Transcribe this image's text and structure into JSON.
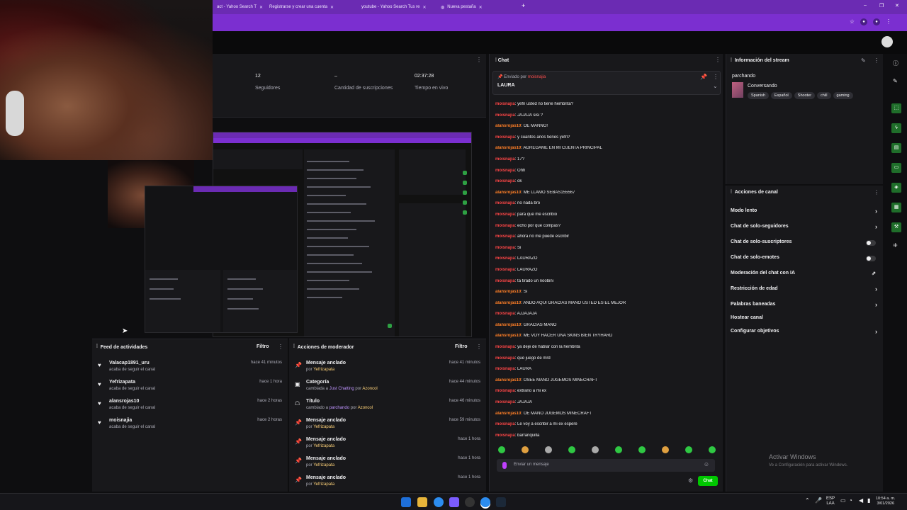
{
  "browser": {
    "tabs": [
      {
        "label": "act - Yahoo Search T"
      },
      {
        "label": "Registrarse y crear una cuenta"
      },
      {
        "label": "youtube - Yahoo Search Tus re"
      },
      {
        "label": "Nueva pestaña"
      }
    ],
    "new_tab": "+",
    "window_controls": [
      "–",
      "❐",
      "✕"
    ]
  },
  "stats": {
    "followers_value": "12",
    "followers_label": "Seguidores",
    "subs_value": "–",
    "subs_label": "Cantidad de suscripciones",
    "live_value": "02:37:28",
    "live_label": "Tiempo en vivo"
  },
  "activity_feed": {
    "title": "Feed de actividades",
    "filter": "Filtro",
    "items": [
      {
        "name": "Valacap1891_uru",
        "desc": "acaba de seguir el canal",
        "time": "hace 41 minutos"
      },
      {
        "name": "Yefrizapata",
        "desc": "acaba de seguir el canal",
        "time": "hace 1 hora"
      },
      {
        "name": "alansrojas10",
        "desc": "acaba de seguir el canal",
        "time": "hace 2 horas"
      },
      {
        "name": "moisnajia",
        "desc": "acaba de seguir el canal",
        "time": "hace 2 horas"
      }
    ]
  },
  "mod_actions": {
    "title": "Acciones de moderador",
    "filter": "Filtro",
    "items": [
      {
        "name": "Mensaje anclado",
        "pre": "por",
        "user": "Yefrizapata",
        "time": "hace 41 minutos"
      },
      {
        "name": "Categoría",
        "pre": "cambiada a",
        "user": "Just Chatting",
        "mid": "por",
        "user2": "Azoncol",
        "time": "hace 44 minutos"
      },
      {
        "name": "Título",
        "pre": "cambiado a",
        "user": "parchando",
        "mid": "por",
        "user2": "Azoncol",
        "time": "hace 46 minutos"
      },
      {
        "name": "Mensaje anclado",
        "pre": "por",
        "user": "Yefrizapata",
        "time": "hace 59 minutos"
      },
      {
        "name": "Mensaje anclado",
        "pre": "por",
        "user": "Yefrizapata",
        "time": "hace 1 hora"
      },
      {
        "name": "Mensaje anclado",
        "pre": "por",
        "user": "Yefrizapata",
        "time": "hace 1 hora"
      },
      {
        "name": "Mensaje anclado",
        "pre": "por",
        "user": "Yefrizapata",
        "time": "hace 1 hora"
      }
    ]
  },
  "chat": {
    "title": "Chat",
    "pinned_by_label": "Enviado por",
    "pinned_by_user": "moisnajia",
    "pinned_message": "LAURA",
    "messages": [
      {
        "user": "moisnajia",
        "color": "red",
        "text": ": yefri usted no tiene hembrita?"
      },
      {
        "user": "moisnajia",
        "color": "red",
        "text": ": JAJAJA sisi ?"
      },
      {
        "user": "alansrojas10",
        "color": "orange",
        "text": ": OE MANNO!"
      },
      {
        "user": "moisnajia",
        "color": "red",
        "text": ": y cuantos años tienes yefri?"
      },
      {
        "user": "alansrojas10",
        "color": "orange",
        "text": ": AGREGAME EN MI CUENTA PRINCIPAL"
      },
      {
        "user": "moisnajia",
        "color": "red",
        "text": ": 17?"
      },
      {
        "user": "moisnajia",
        "color": "red",
        "text": ": Ohh"
      },
      {
        "user": "moisnajia",
        "color": "red",
        "text": ": ok"
      },
      {
        "user": "alansrojas10",
        "color": "orange",
        "text": ": ME LLAMO SEBAS155567"
      },
      {
        "user": "moisnajia",
        "color": "red",
        "text": ": no nada bro"
      },
      {
        "user": "moisnajia",
        "color": "red",
        "text": ": para que me escribio"
      },
      {
        "user": "moisnajia",
        "color": "red",
        "text": ": echo por que compas?"
      },
      {
        "user": "moisnajia",
        "color": "red",
        "text": ": ahora no me puede escribir"
      },
      {
        "user": "moisnajia",
        "color": "red",
        "text": ": Si"
      },
      {
        "user": "moisnajia",
        "color": "red",
        "text": ": LAURAZO"
      },
      {
        "user": "moisnajia",
        "color": "red",
        "text": ": LAURAZO"
      },
      {
        "user": "moisnajia",
        "color": "red",
        "text": ": ta tirado un noobini"
      },
      {
        "user": "alansrojas10",
        "color": "orange",
        "text": ": Si"
      },
      {
        "user": "alansrojas10",
        "color": "orange",
        "text": ": ANDO AQUI GRACIAS MANO USTED ES EL MEJOR"
      },
      {
        "user": "moisnajia",
        "color": "red",
        "text": ": AJJAJAJA"
      },
      {
        "user": "alansrojas10",
        "color": "orange",
        "text": ": GRACIAS MANO"
      },
      {
        "user": "alansrojas10",
        "color": "orange",
        "text": ": ME VOY HACER UNA SKINS BIEN TRYHARD"
      },
      {
        "user": "moisnajia",
        "color": "red",
        "text": ": ya deje de hablar con la hembrita"
      },
      {
        "user": "moisnajia",
        "color": "red",
        "text": ": que juego de mrd"
      },
      {
        "user": "moisnajia",
        "color": "red",
        "text": ": LAURA"
      },
      {
        "user": "alansrojas10",
        "color": "orange",
        "text": ": OSEE MANO JUGEMOS MINECRAFT"
      },
      {
        "user": "moisnajia",
        "color": "red",
        "text": ": extraño a mi ex"
      },
      {
        "user": "moisnajia",
        "color": "red",
        "text": ": JAJAJA"
      },
      {
        "user": "alansrojas10",
        "color": "orange",
        "text": ": OE MANO JUGEMOS MINECRAFT"
      },
      {
        "user": "moisnajia",
        "color": "red",
        "text": ": Le voy a escribir a mi ex espere"
      },
      {
        "user": "moisnajia",
        "color": "red",
        "text": ": barranquilla"
      }
    ],
    "input_placeholder": "Enviar un mensaje",
    "send_label": "Chat"
  },
  "stream_info": {
    "title": "Información del stream",
    "stream_title": "parchando",
    "category": "Conversando",
    "tags": [
      "Spanish",
      "Español",
      "Shooter",
      "chill",
      "gaming"
    ]
  },
  "channel_actions": {
    "title": "Acciones de canal",
    "items": [
      {
        "label": "Modo lento",
        "control": "chevron"
      },
      {
        "label": "Chat de solo-seguidores",
        "control": "chevron"
      },
      {
        "label": "Chat de solo-suscriptores",
        "control": "toggle"
      },
      {
        "label": "Chat de solo-emotes",
        "control": "toggle"
      },
      {
        "label": "Moderación del chat con IA",
        "control": "external"
      },
      {
        "label": "Restricción de edad",
        "control": "chevron"
      },
      {
        "label": "Palabras baneadas",
        "control": "chevron"
      },
      {
        "label": "Hostear canal",
        "control": "none"
      },
      {
        "label": "Configurar objetivos",
        "control": "chevron"
      }
    ]
  },
  "windows_watermark": {
    "line1": "Activar Windows",
    "line2": "Ve a Configuración para activar Windows."
  },
  "taskbar": {
    "lang_top": "ESP",
    "lang_bottom": "LAA",
    "time": "10:54 a. m.",
    "date": "3/01/2026"
  },
  "colors": {
    "browser_purple": "#6b2bb3",
    "chat_send_green": "#00c800",
    "user_red": "#ff4646",
    "user_orange": "#ff7f27"
  }
}
